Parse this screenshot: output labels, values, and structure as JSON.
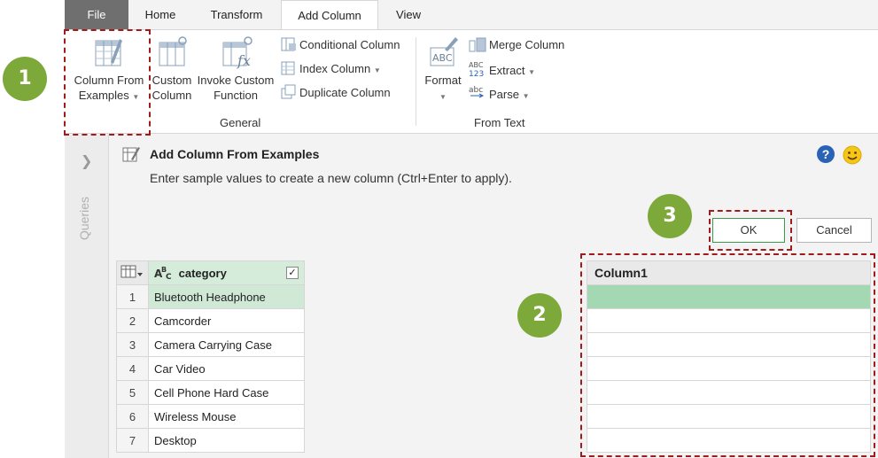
{
  "tabs": {
    "file": "File",
    "home": "Home",
    "transform": "Transform",
    "add_column": "Add Column",
    "view": "View"
  },
  "ribbon": {
    "general": {
      "column_from_examples": [
        "Column From",
        "Examples"
      ],
      "custom_column": [
        "Custom",
        "Column"
      ],
      "invoke_custom_function": [
        "Invoke Custom",
        "Function"
      ],
      "conditional_column": "Conditional Column",
      "index_column": "Index Column",
      "duplicate_column": "Duplicate Column",
      "label": "General"
    },
    "from_text": {
      "format": "Format",
      "merge_column": "Merge Column",
      "extract": "Extract",
      "parse": "Parse",
      "label": "From Text"
    }
  },
  "queries_pane": {
    "label": "Queries"
  },
  "panel": {
    "title": "Add Column From Examples",
    "description": "Enter sample values to create a new column (Ctrl+Enter to apply).",
    "ok_label": "OK",
    "cancel_label": "Cancel",
    "help_symbol": "?"
  },
  "table": {
    "column_type_icon": "abc-type-icon",
    "column_header": "category",
    "rows": [
      {
        "idx": "1",
        "value": "Bluetooth Headphone"
      },
      {
        "idx": "2",
        "value": "Camcorder"
      },
      {
        "idx": "3",
        "value": "Camera Carrying Case"
      },
      {
        "idx": "4",
        "value": "Car Video"
      },
      {
        "idx": "5",
        "value": "Cell Phone Hard Case"
      },
      {
        "idx": "6",
        "value": "Wireless Mouse"
      },
      {
        "idx": "7",
        "value": "Desktop"
      }
    ]
  },
  "new_column": {
    "header": "Column1",
    "rows": [
      "",
      "",
      "",
      "",
      "",
      "",
      ""
    ]
  },
  "annotations": {
    "badge1": "1",
    "badge2": "2",
    "badge3": "3",
    "badge_color": "#7da83a",
    "highlight_color": "#a01c1c"
  }
}
